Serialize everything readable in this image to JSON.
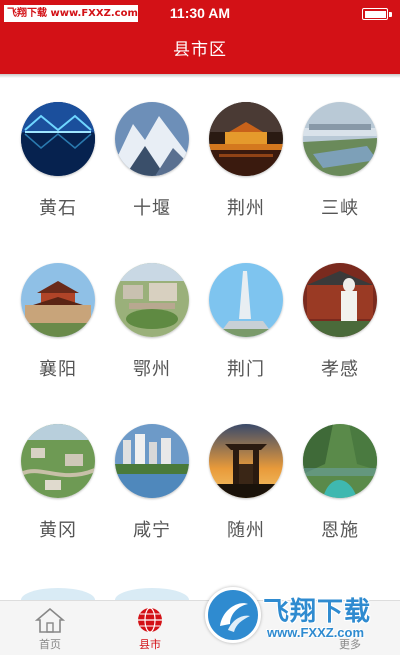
{
  "status_bar": {
    "watermark": "飞翔下载 www.FXXZ.com",
    "time": "11:30 AM",
    "battery_level": 1.0
  },
  "header": {
    "title": "县市区"
  },
  "cities": [
    {
      "name": "黄石",
      "icon": "bridge-night-photo"
    },
    {
      "name": "十堰",
      "icon": "snowy-mountain-photo"
    },
    {
      "name": "荆州",
      "icon": "city-gate-night-photo"
    },
    {
      "name": "三峡",
      "icon": "dam-river-photo"
    },
    {
      "name": "襄阳",
      "icon": "ancient-tower-photo"
    },
    {
      "name": "鄂州",
      "icon": "aerial-town-photo"
    },
    {
      "name": "荆门",
      "icon": "monument-photo"
    },
    {
      "name": "孝感",
      "icon": "statue-photo"
    },
    {
      "name": "黄冈",
      "icon": "aerial-green-city-photo"
    },
    {
      "name": "咸宁",
      "icon": "lake-city-photo"
    },
    {
      "name": "随州",
      "icon": "sunset-pavilion-photo"
    },
    {
      "name": "恩施",
      "icon": "canyon-river-photo"
    }
  ],
  "tabs": [
    {
      "label": "首页",
      "icon": "home-icon",
      "active": false
    },
    {
      "label": "县市",
      "icon": "globe-icon",
      "active": true
    },
    {
      "label": "",
      "icon": "",
      "active": false
    },
    {
      "label": "更多",
      "icon": "more-icon",
      "active": false
    }
  ],
  "watermark": {
    "text": "飞翔下载",
    "url": "www.FXXZ.com"
  },
  "colors": {
    "brand": "#d31116",
    "watermark": "#2f8bd0"
  }
}
